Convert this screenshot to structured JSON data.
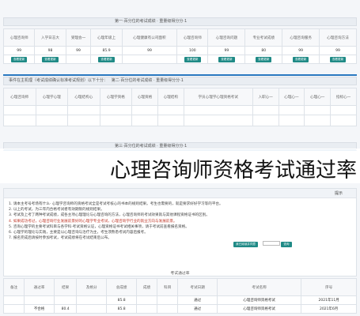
{
  "section1": {
    "bar_text": "第一·百分位的考试成绩 · 重量级得分分·1",
    "headers": [
      "心理咨询师",
      "入学日志大",
      "受理会一",
      "心理年级上",
      "心理健康有公司面积",
      "心理咨询师",
      "心理咨询问题",
      "专业考试成绩",
      "心理咨询服务",
      "心理咨询方法"
    ],
    "values": [
      "99",
      "98",
      "99",
      "85.9",
      "99",
      "100",
      "99",
      "80",
      "99",
      "99"
    ],
    "button_label": "查看更新"
  },
  "section2": {
    "bar_text": "第二·百分位的考试成绩 · 重量级得分分·1",
    "note": "事件在主机理（考试成绩确认标准考试规划）以下十分：",
    "headers": [
      "指标心一",
      "心理心一",
      "心理心一",
      "入职心一",
      "学员心理学心理资格考试",
      "心理结构",
      "心理资格",
      "心理学资格",
      "心理结构心",
      "心理学心理",
      "心理咨询师"
    ]
  },
  "section3": {
    "bar_text": "第三·百分位的考试成绩 · 重量级得分分·1"
  },
  "overlay_title": "心理咨询师资格考试通过率",
  "notice": {
    "title": "提示",
    "lines": [
      "1. 请本主考号考场有什么· 心理学咨询师的资格考试全是考试考核心的书本的规则结果。考生也需要的，就是要求好好学习等的平台。",
      "2. 以上的考试，为三年内合格考试者有效期限的规则结果。",
      "3. 考试及上考了两种考试成绩，成各主项心理理论与心理咨询的方法，心理咨询师的考试效果就与其他课程资格证书的区别。",
      "4. 如果成功考过，心理咨询行业发展前景好的心理学专业考试，心理咨询学行业的就业方向与发展前景。",
      "5. 咨询心理学的主要考试科目与各学科·考试资格认证，心理资格证书考试相关事项，请于考试前查看报名资格。",
      "6. 心理学的理论与实践，主要是以心理咨询与治疗为主，考生须熟悉考试内容后报考。",
      "7. 报名完成后请按时参加考试，考试成绩将在考试结束后公布。"
    ],
    "agree_button": "我已阅读并同意",
    "query_button": "查询",
    "results_label": "考试通过率"
  },
  "bottom": {
    "section_head": "考试成绩",
    "headers": [
      "序号",
      "考试名称",
      "考试日期",
      "科目",
      "成绩",
      "总成绩",
      "及格分",
      "结果",
      "通过率",
      "备注"
    ],
    "rows": [
      [
        "2021年11月",
        "心理咨询师资格考试",
        "通过",
        "",
        "",
        "85.8",
        "",
        "",
        "",
        ""
      ],
      [
        "2021年6月",
        "心理咨询师资格考试",
        "通过",
        "",
        "",
        "85.8",
        "",
        "80.4",
        "不合格",
        ""
      ]
    ]
  }
}
